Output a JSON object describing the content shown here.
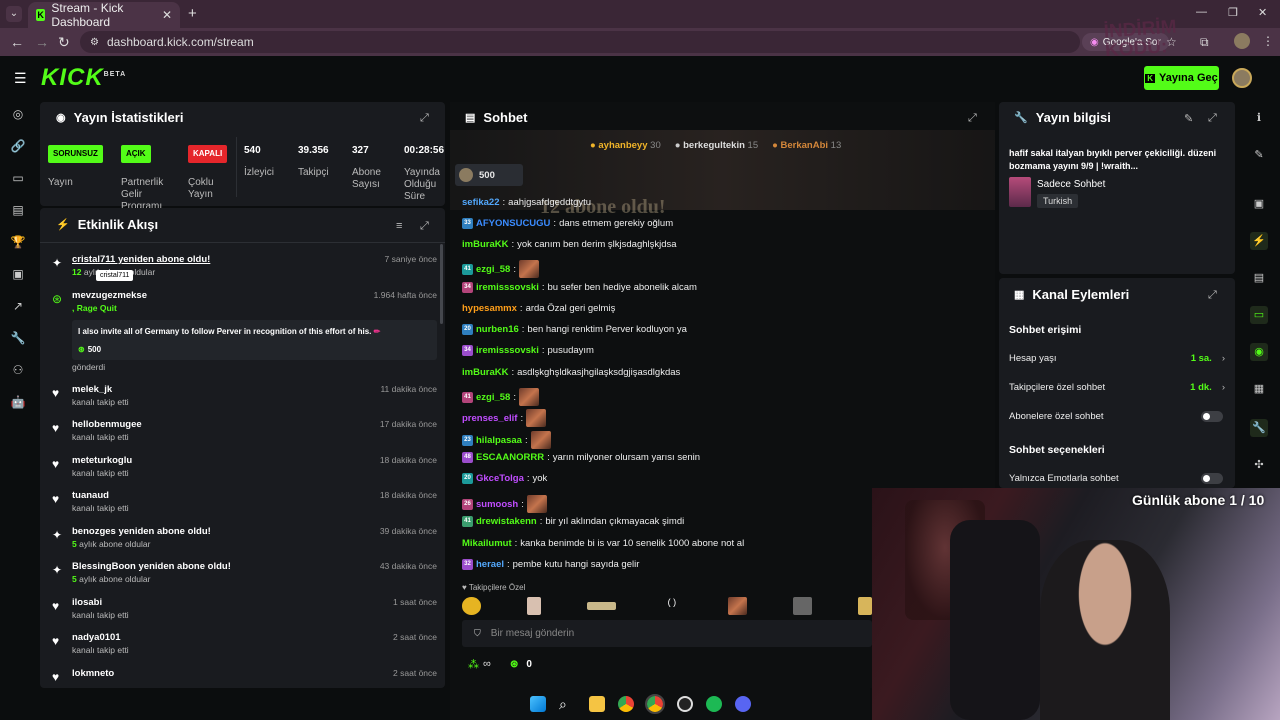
{
  "browser": {
    "tab_title": "Stream - Kick Dashboard",
    "url": "dashboard.kick.com/stream",
    "google_ask": "Google'a Sor",
    "overlay_text": "İNDİRİM KODU: PERVER"
  },
  "header": {
    "logo": "KICK",
    "logo_tag": "BETA",
    "go_live": "Yayına Geç"
  },
  "stats": {
    "title": "Yayın İstatistikleri",
    "items": [
      {
        "badge": "SORUNSUZ",
        "label": "Yayın",
        "badge_color": "#53fc18"
      },
      {
        "badge": "AÇIK",
        "label": "Partnerlik Gelir Programı",
        "badge_color": "#53fc18"
      },
      {
        "badge": "KAPALI",
        "label": "Çoklu Yayın",
        "badge_color": "#e5262b"
      },
      {
        "value": "540",
        "label": "İzleyici"
      },
      {
        "value": "39.356",
        "label": "Takipçi"
      },
      {
        "value": "327",
        "label": "Abone Sayısı"
      },
      {
        "value": "00:28:56",
        "label": "Yayında Olduğu Süre"
      }
    ]
  },
  "activity": {
    "title": "Etkinlik Akışı",
    "tooltip": "cristal711",
    "items": [
      {
        "name": "cristal711 yeniden abone oldu!",
        "sub_num": "12",
        "sub_text": "aylık abone oldular",
        "time": "7 saniye önce"
      },
      {
        "name": "mevzugezmekse",
        "sub_num": "",
        "sub_text": ", Rage Quit",
        "time": "1.964 hafta önce",
        "message": "I also invite all of Germany to follow Perver in recognition of this effort of his. ",
        "amount": "500",
        "after": "gönderdi"
      },
      {
        "name": "melek_jk",
        "sub_num": "",
        "sub_text": "kanalı takip etti",
        "time": "11 dakika önce"
      },
      {
        "name": "hellobenmugee",
        "sub_num": "",
        "sub_text": "kanalı takip etti",
        "time": "17 dakika önce"
      },
      {
        "name": "meteturkoglu",
        "sub_num": "",
        "sub_text": "kanalı takip etti",
        "time": "18 dakika önce"
      },
      {
        "name": "tuanaud",
        "sub_num": "",
        "sub_text": "kanalı takip etti",
        "time": "18 dakika önce"
      },
      {
        "name": "benozges yeniden abone oldu!",
        "sub_num": "5",
        "sub_text": "aylık abone oldular",
        "time": "39 dakika önce"
      },
      {
        "name": "BlessingBoon yeniden abone oldu!",
        "sub_num": "5",
        "sub_text": "aylık abone oldular",
        "time": "43 dakika önce"
      },
      {
        "name": "ilosabi",
        "sub_num": "",
        "sub_text": "kanalı takip etti",
        "time": "1 saat önce"
      },
      {
        "name": "nadya0101",
        "sub_num": "",
        "sub_text": "kanalı takip etti",
        "time": "2 saat önce"
      },
      {
        "name": "lokmneto",
        "sub_num": "",
        "sub_text": "kanalı takip etti",
        "time": "2 saat önce"
      }
    ]
  },
  "chat": {
    "title": "Sohbet",
    "top_gifters": [
      {
        "name": "ayhanbeyy",
        "count": "30"
      },
      {
        "name": "berkegultekin",
        "count": "15"
      },
      {
        "name": "BerkanAbi",
        "count": "13"
      }
    ],
    "pinned_amount": "500",
    "banner_text": "12 abone oldu!",
    "messages": [
      {
        "badge": "",
        "user": "sefika22",
        "color": "#53a8fc",
        "text": "aahjgsafdgeddtgytu"
      },
      {
        "badge": "33",
        "user": "AFYONSUCUGU",
        "color": "#3b8cff",
        "text": "dans etmem gerekiy oğlum"
      },
      {
        "badge": "",
        "user": "imBuraKK",
        "color": "#53fc18",
        "text": "yok canım ben derim şlkjsdaghlşkjdsa"
      },
      {
        "badge": "41",
        "user": "ezgi_58",
        "color": "#53fc18",
        "text": "",
        "emote": true
      },
      {
        "badge": "34",
        "user": "iremisssovski",
        "color": "#53fc18",
        "text": "bu sefer ben hediye abonelik alcam"
      },
      {
        "badge": "",
        "user": "hypesammx",
        "color": "#ff9f1a",
        "text": "arda Özal geri gelmiş"
      },
      {
        "badge": "20",
        "user": "nurben16",
        "color": "#53fc18",
        "text": "ben hangi renktim Perver kodluyon ya"
      },
      {
        "badge": "34",
        "user": "iremisssovski",
        "color": "#53fc18",
        "text": "pusudayım"
      },
      {
        "badge": "",
        "user": "imBuraKK",
        "color": "#53fc18",
        "text": "asdlşkghşldkasjhgilaşksdgjişasdlgkdas"
      },
      {
        "badge": "41",
        "user": "ezgi_58",
        "color": "#53fc18",
        "text": "",
        "emote": true
      },
      {
        "badge": "",
        "user": "prenses_elif",
        "color": "#c04dff",
        "text": "",
        "emote": true
      },
      {
        "badge": "23",
        "user": "hilalpasaa",
        "color": "#53fc18",
        "text": "",
        "emote": true
      },
      {
        "badge": "48",
        "user": "ESCAANORRR",
        "color": "#53fc18",
        "text": "yarın milyoner olursam yarısı senin"
      },
      {
        "badge": "20",
        "user": "GkceTolga",
        "color": "#c04dff",
        "text": "yok"
      },
      {
        "badge": "26",
        "user": "sumoosh",
        "color": "#c04dff",
        "text": "",
        "emote": true
      },
      {
        "badge": "41",
        "user": "drewistakenn",
        "color": "#53fc18",
        "text": "bir yıl aklından çıkmayacak şimdi"
      },
      {
        "badge": "",
        "user": "Mikailumut",
        "color": "#53fc18",
        "text": "kanka benimde bi is var 10 senelik 1000 abone not al"
      },
      {
        "badge": "32",
        "user": "herael",
        "color": "#53a8fc",
        "text": "pembe kutu hangi sayıda gelir"
      }
    ],
    "followers_only": "Takipçilere Özel",
    "input_placeholder": "Bir mesaj gönderin",
    "infinity": "∞",
    "points": "0"
  },
  "info": {
    "title": "Yayın bilgisi",
    "stream_title": "hafif sakal italyan bıyıklı perver çekiciliği. düzeni bozmama yayını 9/9 | !wraith...",
    "category": "Sadece Sohbet",
    "language": "Turkish"
  },
  "actions": {
    "title": "Kanal Eylemleri",
    "section1": "Sohbet erişimi",
    "rows": [
      {
        "label": "Hesap yaşı",
        "value": "1 sa."
      },
      {
        "label": "Takipçilere özel sohbet",
        "value": "1 dk."
      },
      {
        "label": "Abonelere özel sohbet",
        "value": ""
      }
    ],
    "section2": "Sohbet seçenekleri",
    "row_emote": "Yalnızca Emotlarla sohbet"
  },
  "overlay": {
    "daily_sub": "Günlük abone 1 / 10"
  }
}
